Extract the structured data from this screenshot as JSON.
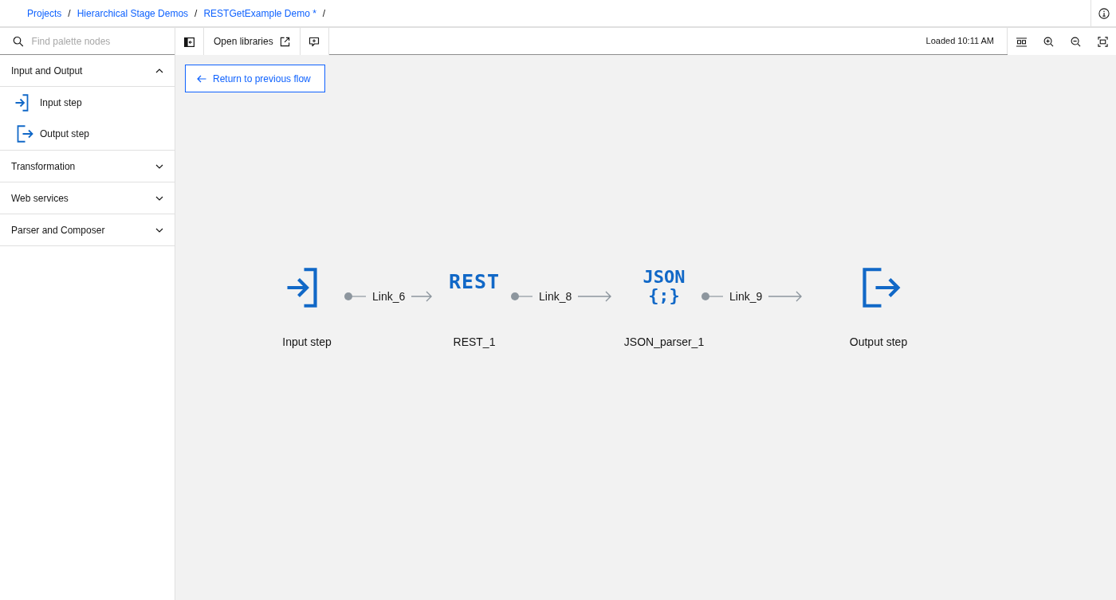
{
  "breadcrumbs": [
    {
      "label": "Projects"
    },
    {
      "label": "Hierarchical Stage Demos"
    },
    {
      "label": "RESTGetExample Demo *"
    }
  ],
  "breadcrumb_separator": "/",
  "palette": {
    "search": {
      "placeholder": "Find palette nodes"
    },
    "categories": [
      {
        "label": "Input and Output",
        "expanded": true,
        "items": [
          {
            "label": "Input step",
            "kind": "input"
          },
          {
            "label": "Output step",
            "kind": "output"
          }
        ]
      },
      {
        "label": "Transformation",
        "expanded": false
      },
      {
        "label": "Web services",
        "expanded": false
      },
      {
        "label": "Parser and Composer",
        "expanded": false
      }
    ]
  },
  "toolbar": {
    "open_libraries": "Open libraries",
    "status": "Loaded 10:11 AM"
  },
  "return_button": "Return to previous flow",
  "nodes": [
    {
      "label": "Input step",
      "kind": "input"
    },
    {
      "label": "REST_1",
      "kind": "rest",
      "icon_text": "REST"
    },
    {
      "label": "JSON_parser_1",
      "kind": "json",
      "icon_text": "JSON",
      "icon_text_2": "{;}"
    },
    {
      "label": "Output step",
      "kind": "output"
    }
  ],
  "links": [
    {
      "label": "Link_6"
    },
    {
      "label": "Link_8"
    },
    {
      "label": "Link_9"
    }
  ]
}
